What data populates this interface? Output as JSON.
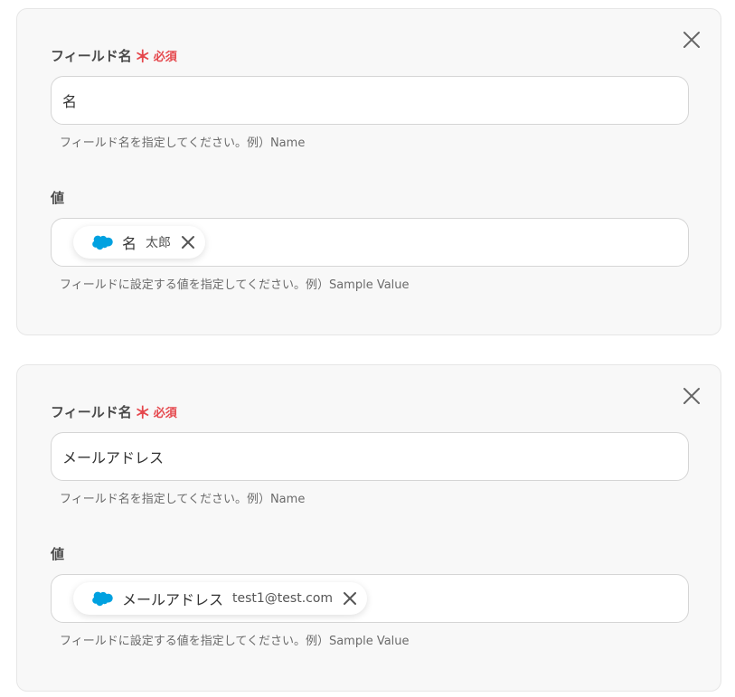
{
  "fields": [
    {
      "label": "フィールド名",
      "required_mark": "＊",
      "required_text": "必須",
      "name_value": "名",
      "name_hint": "フィールド名を指定してください。例）Name",
      "value_label": "値",
      "chip": {
        "icon": "salesforce-cloud-icon",
        "label": "名",
        "value": "太郎"
      },
      "value_hint": "フィールドに設定する値を指定してください。例）Sample Value"
    },
    {
      "label": "フィールド名",
      "required_mark": "＊",
      "required_text": "必須",
      "name_value": "メールアドレス",
      "name_hint": "フィールド名を指定してください。例）Name",
      "value_label": "値",
      "chip": {
        "icon": "salesforce-cloud-icon",
        "label": "メールアドレス",
        "value": "test1@test.com"
      },
      "value_hint": "フィールドに設定する値を指定してください。例）Sample Value"
    }
  ],
  "colors": {
    "required": "#e5484d",
    "card_background": "#f8f8f8",
    "salesforce_blue": "#00a1e0"
  }
}
